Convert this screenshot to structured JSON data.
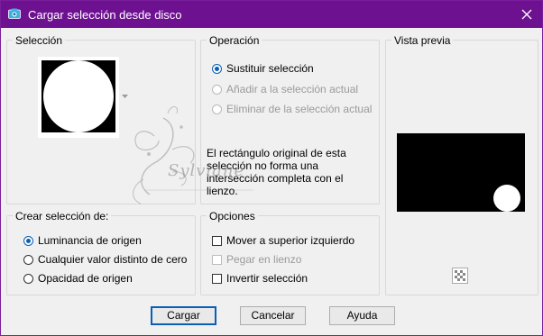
{
  "window": {
    "title": "Cargar selección desde disco",
    "icons": {
      "app": "camera-icon",
      "close": "close-icon"
    }
  },
  "seleccion": {
    "legend": "Selección"
  },
  "operacion": {
    "legend": "Operación",
    "options": [
      {
        "label": "Sustituir selección",
        "selected": true,
        "enabled": true
      },
      {
        "label": "Añadir a la selección actual",
        "selected": false,
        "enabled": false
      },
      {
        "label": "Eliminar de la selección actual",
        "selected": false,
        "enabled": false
      }
    ],
    "note": "El rectángulo original de esta selección no forma una intersección completa con el lienzo."
  },
  "vista_previa": {
    "legend": "Vista previa",
    "icon": "checker-icon"
  },
  "crear": {
    "legend": "Crear selección de:",
    "options": [
      {
        "label": "Luminancia de origen",
        "selected": true
      },
      {
        "label": "Cualquier valor distinto de cero",
        "selected": false
      },
      {
        "label": "Opacidad de origen",
        "selected": false
      }
    ]
  },
  "opciones": {
    "legend": "Opciones",
    "items": [
      {
        "label": "Mover a superior izquierdo",
        "checked": false,
        "enabled": true
      },
      {
        "label": "Pegar en lienzo",
        "checked": false,
        "enabled": false
      },
      {
        "label": "Invertir selección",
        "checked": false,
        "enabled": true
      }
    ]
  },
  "buttons": {
    "ok": "Cargar",
    "cancel": "Cancelar",
    "help": "Ayuda"
  },
  "watermark": "Sylviane"
}
